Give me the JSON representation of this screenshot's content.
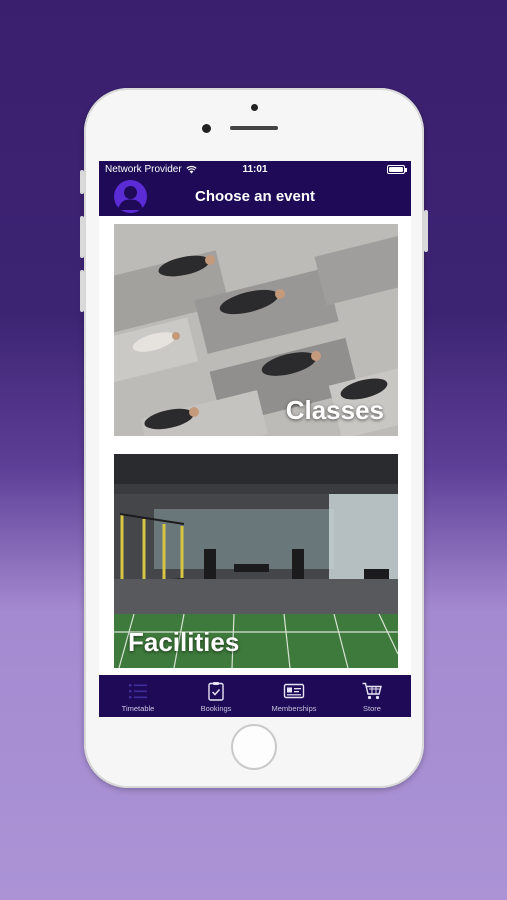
{
  "status_bar": {
    "carrier": "Network Provider",
    "time": "11:01"
  },
  "header": {
    "title": "Choose an event"
  },
  "cards": [
    {
      "label": "Classes"
    },
    {
      "label": "Facilities"
    }
  ],
  "tabs": [
    {
      "label": "Timetable",
      "icon": "list-icon",
      "active": true
    },
    {
      "label": "Bookings",
      "icon": "clipboard-check-icon",
      "active": false
    },
    {
      "label": "Memberships",
      "icon": "membership-card-icon",
      "active": false
    },
    {
      "label": "Store",
      "icon": "cart-icon",
      "active": false
    }
  ],
  "colors": {
    "brand": "#1e0a57",
    "avatar": "#5b2bd6",
    "background_top": "#3a1f6e",
    "background_bottom": "#ab93d6"
  }
}
